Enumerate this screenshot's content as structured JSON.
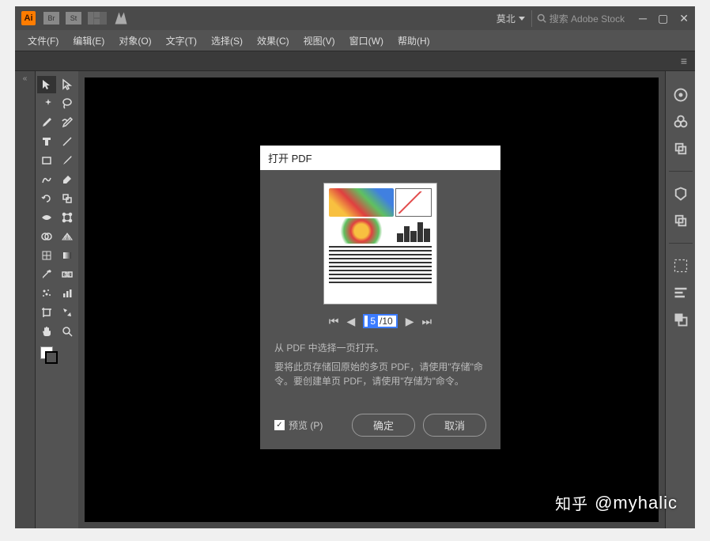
{
  "titlebar": {
    "br_label": "Br",
    "st_label": "St",
    "workspace_name": "莫北",
    "search_placeholder": "搜索 Adobe Stock"
  },
  "menu": {
    "file": "文件(F)",
    "edit": "编辑(E)",
    "object": "对象(O)",
    "type": "文字(T)",
    "select": "选择(S)",
    "effect": "效果(C)",
    "view": "视图(V)",
    "window": "窗口(W)",
    "help": "帮助(H)"
  },
  "dialog": {
    "title": "打开 PDF",
    "page_current": "5",
    "page_total": "/10",
    "instruction": "从 PDF 中选择一页打开。",
    "note": "要将此页存储回原始的多页 PDF，请使用\"存储\"命令。要创建单页 PDF，请使用\"存储为\"命令。",
    "preview_label": "预览 (P)",
    "ok_label": "确定",
    "cancel_label": "取消"
  },
  "watermark": {
    "brand": "知乎",
    "user": "@myhalic"
  }
}
